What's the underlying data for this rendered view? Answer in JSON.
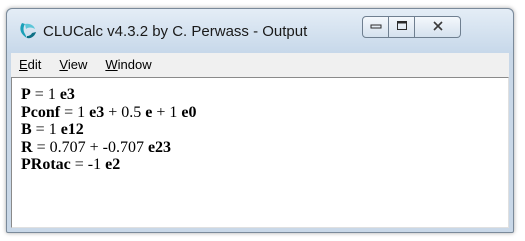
{
  "window": {
    "title": "CLUCalc v4.3.2 by C. Perwass - Output"
  },
  "menu": [
    {
      "accel": "E",
      "rest": "dit"
    },
    {
      "accel": "V",
      "rest": "iew"
    },
    {
      "accel": "W",
      "rest": "indow"
    }
  ],
  "output": {
    "lines": [
      {
        "name": "P",
        "eq": " = ",
        "terms": [
          {
            "coef": "1 ",
            "basis": "e3",
            "sep": ""
          }
        ]
      },
      {
        "name": "Pconf",
        "eq": " = ",
        "terms": [
          {
            "coef": "1 ",
            "basis": "e3",
            "sep": " + "
          },
          {
            "coef": "0.5 ",
            "basis": "e",
            "sep": " + "
          },
          {
            "coef": "1 ",
            "basis": "e0",
            "sep": ""
          }
        ]
      },
      {
        "name": "B",
        "eq": " = ",
        "terms": [
          {
            "coef": "1 ",
            "basis": "e12",
            "sep": ""
          }
        ]
      },
      {
        "name": "R",
        "eq": " = ",
        "terms": [
          {
            "coef": "0.707",
            "basis": "",
            "sep": " + "
          },
          {
            "coef": "-0.707 ",
            "basis": "e23",
            "sep": ""
          }
        ]
      },
      {
        "name": "PRotac",
        "eq": " = ",
        "terms": [
          {
            "coef": "-1 ",
            "basis": "e2",
            "sep": ""
          }
        ]
      }
    ]
  },
  "colors": {
    "icon_accent": "#1aa0b8",
    "frame": "#c9d8e8"
  },
  "icons": {
    "app": "clucalc-app-icon",
    "minimize": "minimize-icon",
    "maximize": "maximize-icon",
    "close": "close-icon"
  }
}
